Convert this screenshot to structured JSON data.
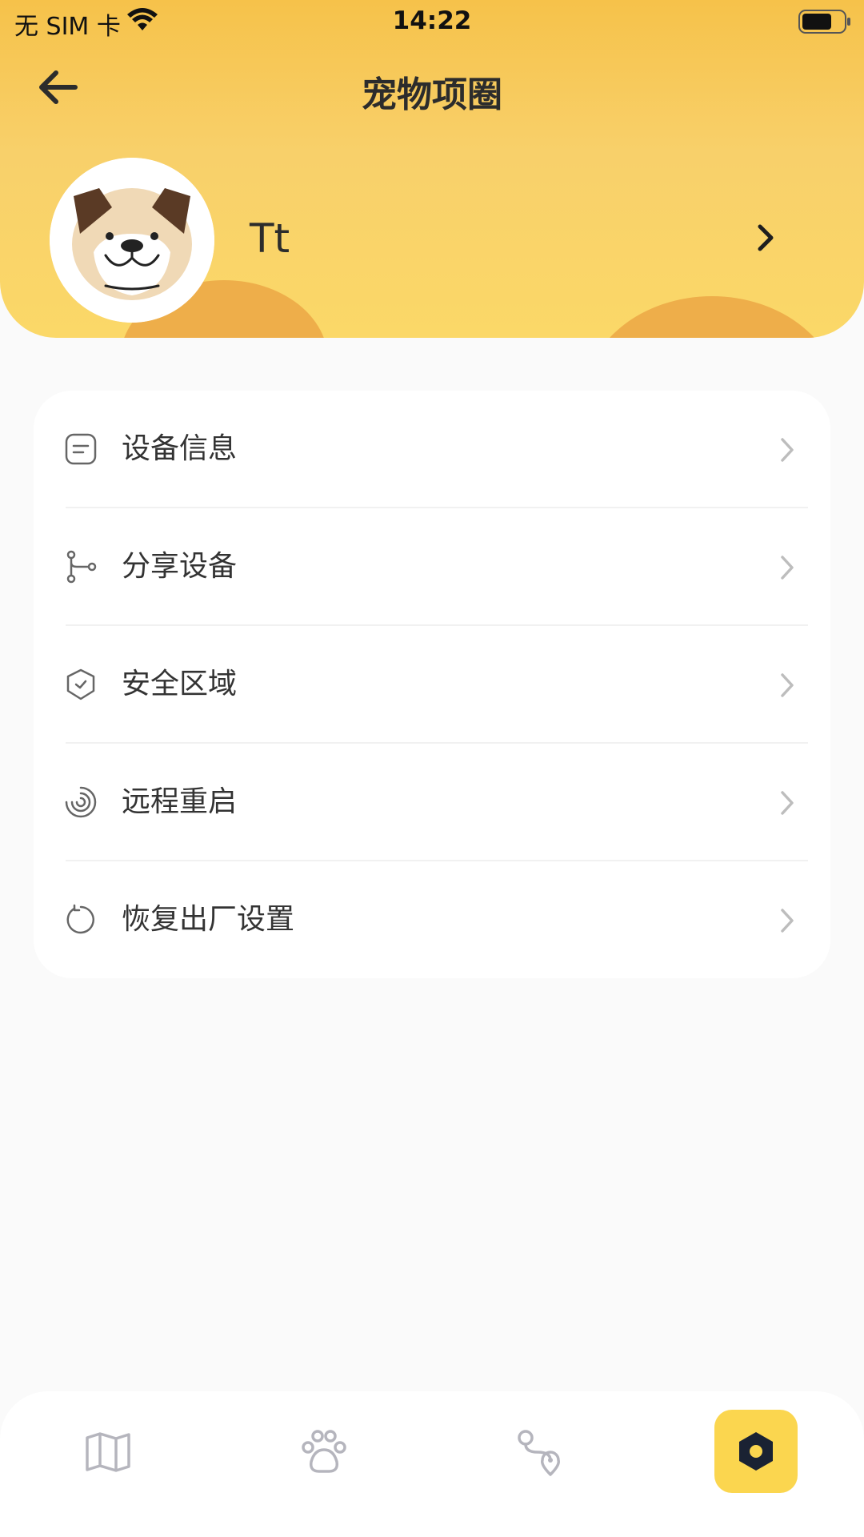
{
  "status_bar": {
    "carrier": "无 SIM 卡",
    "time": "14:22"
  },
  "nav": {
    "title": "宠物项圈",
    "back_icon": "arrow-left-icon"
  },
  "profile": {
    "name": "Tt",
    "avatar_icon": "bulldog-avatar"
  },
  "menu": {
    "items": [
      {
        "label": "设备信息",
        "icon": "document-icon"
      },
      {
        "label": "分享设备",
        "icon": "share-branch-icon"
      },
      {
        "label": "安全区域",
        "icon": "shield-check-icon"
      },
      {
        "label": "远程重启",
        "icon": "restart-spiral-icon"
      },
      {
        "label": "恢复出厂设置",
        "icon": "reset-circle-icon"
      }
    ]
  },
  "tabbar": {
    "tabs": [
      {
        "icon": "map-icon",
        "active": false
      },
      {
        "icon": "paw-icon",
        "active": false
      },
      {
        "icon": "route-icon",
        "active": false
      },
      {
        "icon": "settings-hex-icon",
        "active": true
      }
    ]
  },
  "colors": {
    "accent": "#fbd64f",
    "header": "#f6c24a",
    "text": "#333333",
    "icon_gray": "#9a9a9a"
  }
}
